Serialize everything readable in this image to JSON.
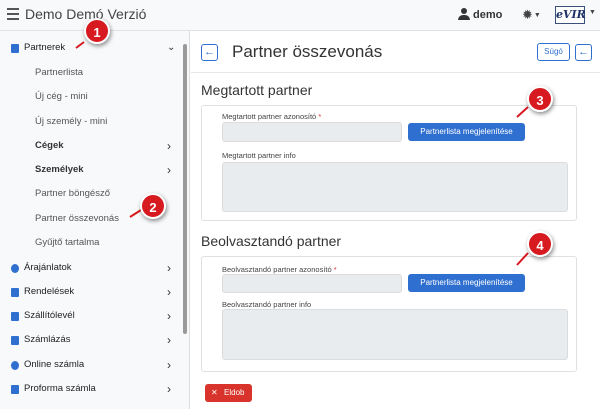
{
  "app": {
    "title": "Demo Demó Verzió",
    "user": "demo",
    "logo_text": "eVIR"
  },
  "sidebar": {
    "partners": {
      "label": "Partnerek",
      "children": [
        "Partnerlista",
        "Új cég - mini",
        "Új személy - mini",
        "Cégek",
        "Személyek",
        "Partner böngésző",
        "Partner összevonás",
        "Gyűjtő tartalma"
      ]
    },
    "items": [
      {
        "label": "Árajánlatok",
        "icon": "price-quote-icon"
      },
      {
        "label": "Rendelések",
        "icon": "orders-icon"
      },
      {
        "label": "Szállítólevél",
        "icon": "delivery-note-icon"
      },
      {
        "label": "Számlázás",
        "icon": "invoicing-icon"
      },
      {
        "label": "Online számla",
        "icon": "globe-icon"
      },
      {
        "label": "Proforma számla",
        "icon": "proforma-icon"
      }
    ]
  },
  "page": {
    "title": "Partner összevonás",
    "help_label": "Súgó"
  },
  "kept": {
    "title": "Megtartott partner",
    "id_label": "Megtartott partner azonosító",
    "id_value": "",
    "list_button": "Partnerlista megjelenítése",
    "info_label": "Megtartott partner info",
    "info_value": ""
  },
  "merged": {
    "title": "Beolvasztandó partner",
    "id_label": "Beolvasztandó partner azonosító",
    "id_value": "",
    "list_button": "Partnerlista megjelenítése",
    "info_label": "Beolvasztandó partner info",
    "info_value": ""
  },
  "discard_label": "Eldob",
  "required_mark": "*",
  "callouts": [
    "1",
    "2",
    "3",
    "4"
  ],
  "colors": {
    "accent": "#2f6fcf",
    "danger": "#d9342b",
    "callout": "#d71920"
  }
}
